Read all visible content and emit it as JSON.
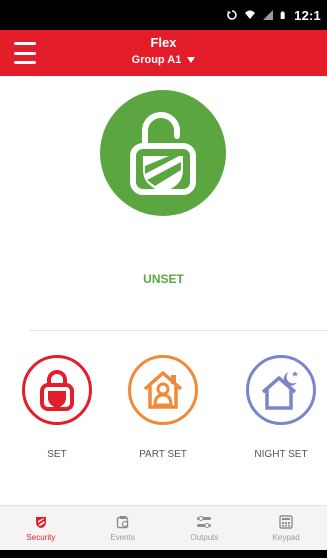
{
  "status_bar": {
    "time": "12:1",
    "icons": [
      "rotate-icon",
      "wifi-icon",
      "signal-icon",
      "battery-icon"
    ]
  },
  "app_bar": {
    "title": "Flex",
    "group_label": "Group A1",
    "menu_icon": "hamburger-menu-icon"
  },
  "main": {
    "status_text": "UNSET",
    "status_color": "#5ca642",
    "icon": "unlocked-padlock-shield-icon"
  },
  "modes": [
    {
      "label": "SET",
      "icon": "locked-padlock-icon",
      "color": "#e31e2a"
    },
    {
      "label": "PART SET",
      "icon": "house-person-icon",
      "color": "#f08a3a"
    },
    {
      "label": "NIGHT SET",
      "icon": "house-moon-icon",
      "color": "#7a86c9"
    }
  ],
  "bottom_nav": [
    {
      "label": "Security",
      "icon": "security-icon",
      "active": true
    },
    {
      "label": "Events",
      "icon": "events-icon",
      "active": false
    },
    {
      "label": "Outputs",
      "icon": "outputs-icon",
      "active": false
    },
    {
      "label": "Keypad",
      "icon": "keypad-icon",
      "active": false
    }
  ],
  "colors": {
    "brand_red": "#e31e2a",
    "unset_green": "#5ca642",
    "part_orange": "#f08a3a",
    "night_blue": "#7a86c9"
  }
}
